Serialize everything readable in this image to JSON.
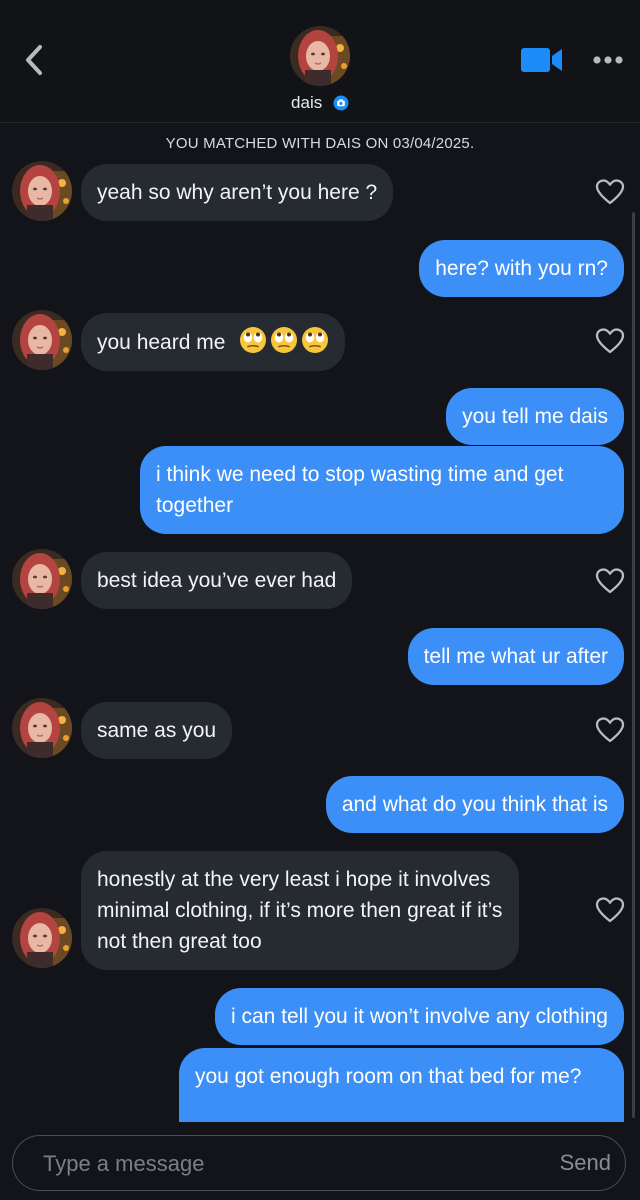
{
  "header": {
    "name": "dais",
    "back_icon": "chevron-left-icon",
    "video_icon": "video-camera-icon",
    "more_icon": "ellipsis-icon",
    "verified_icon": "verified-badge-icon",
    "accent_color": "#1d8cf8"
  },
  "match_banner": "YOU MATCHED WITH DAIS ON 03/04/2025.",
  "messages": [
    {
      "sender": "dais",
      "text": "yeah so why aren’t you here ?"
    },
    {
      "sender": "me",
      "text": "here? with you rn?"
    },
    {
      "sender": "dais",
      "text": "you heard me",
      "emoji": [
        "face-with-rolling-eyes",
        "face-with-rolling-eyes",
        "face-with-rolling-eyes"
      ]
    },
    {
      "sender": "me",
      "text": "you tell me dais"
    },
    {
      "sender": "me",
      "text": "i think we need to stop wasting time and get together"
    },
    {
      "sender": "dais",
      "text": "best idea you’ve ever had"
    },
    {
      "sender": "me",
      "text": "tell me what ur after"
    },
    {
      "sender": "dais",
      "text": "same as you"
    },
    {
      "sender": "me",
      "text": "and what do you think that is"
    },
    {
      "sender": "dais",
      "text": "honestly at the very least i hope it involves minimal clothing, if it’s more then great if it’s not then great too"
    },
    {
      "sender": "me",
      "text": "i can tell you it won’t involve any clothing"
    },
    {
      "sender": "me",
      "text": "you got enough room on that bed for me?"
    }
  ],
  "composer": {
    "placeholder": "Type a message",
    "value": "",
    "send_label": "Send"
  },
  "colors": {
    "background": "#121419",
    "incoming_bubble": "#262a31",
    "outgoing_bubble": "#3c8ff6",
    "heart_outline": "#b9bcc4"
  }
}
